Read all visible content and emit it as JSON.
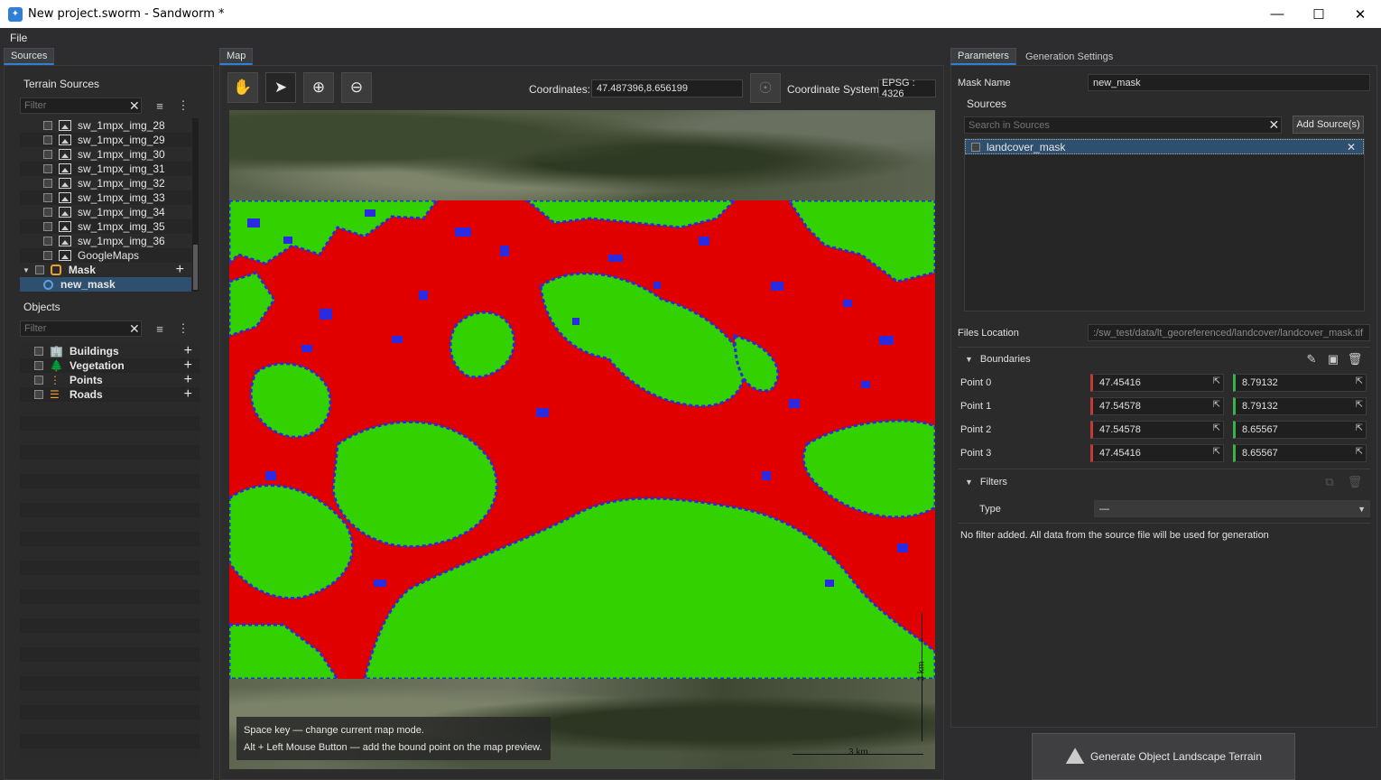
{
  "window": {
    "title": "New project.sworm - Sandworm *"
  },
  "menu": {
    "file": "File"
  },
  "left": {
    "tab_sources": "Sources",
    "terrain_sources_label": "Terrain Sources",
    "filter_placeholder": "Filter",
    "terrain_items": [
      "sw_1mpx_img_28",
      "sw_1mpx_img_29",
      "sw_1mpx_img_30",
      "sw_1mpx_img_31",
      "sw_1mpx_img_32",
      "sw_1mpx_img_33",
      "sw_1mpx_img_34",
      "sw_1mpx_img_35",
      "sw_1mpx_img_36",
      "GoogleMaps"
    ],
    "mask_group": "Mask",
    "mask_item": "new_mask",
    "objects_label": "Objects",
    "objects_filter_placeholder": "Filter",
    "objects": [
      "Buildings",
      "Vegetation",
      "Points",
      "Roads"
    ]
  },
  "map": {
    "tab": "Map",
    "coordinates_label": "Coordinates:",
    "coordinates_value": "47.487396,8.656199",
    "coordinate_system_label": "Coordinate System:",
    "coordinate_system_value": "EPSG : 4326",
    "hint_line1": "Space key — change current map mode.",
    "hint_line2": "Alt + Left Mouse Button — add the bound point on the map preview.",
    "scale_v": "3 km",
    "scale_h": "3 km"
  },
  "right": {
    "tab_parameters": "Parameters",
    "tab_generation_settings": "Generation Settings",
    "mask_name_label": "Mask Name",
    "mask_name_value": "new_mask",
    "sources_label": "Sources",
    "search_placeholder": "Search in Sources",
    "add_sources_button": "Add Source(s)",
    "source_item": "landcover_mask",
    "files_location_label": "Files Location",
    "files_location_value": ":/sw_test/data/lt_georeferenced/landcover/landcover_mask.tif",
    "boundaries_label": "Boundaries",
    "points": [
      {
        "label": "Point 0",
        "lat": "47.45416",
        "lon": "8.79132"
      },
      {
        "label": "Point 1",
        "lat": "47.54578",
        "lon": "8.79132"
      },
      {
        "label": "Point 2",
        "lat": "47.54578",
        "lon": "8.65567"
      },
      {
        "label": "Point 3",
        "lat": "47.45416",
        "lon": "8.65567"
      }
    ],
    "filters_label": "Filters",
    "type_label": "Type",
    "type_value": "—",
    "no_filter_text": "No filter added. All data from the source file will be used for generation",
    "generate_button": "Generate Object Landscape Terrain"
  },
  "colors": {
    "mask_red": "#e00000",
    "mask_green": "#33d100",
    "mask_blue": "#2a2ae0",
    "accent": "#2f7fd6"
  }
}
